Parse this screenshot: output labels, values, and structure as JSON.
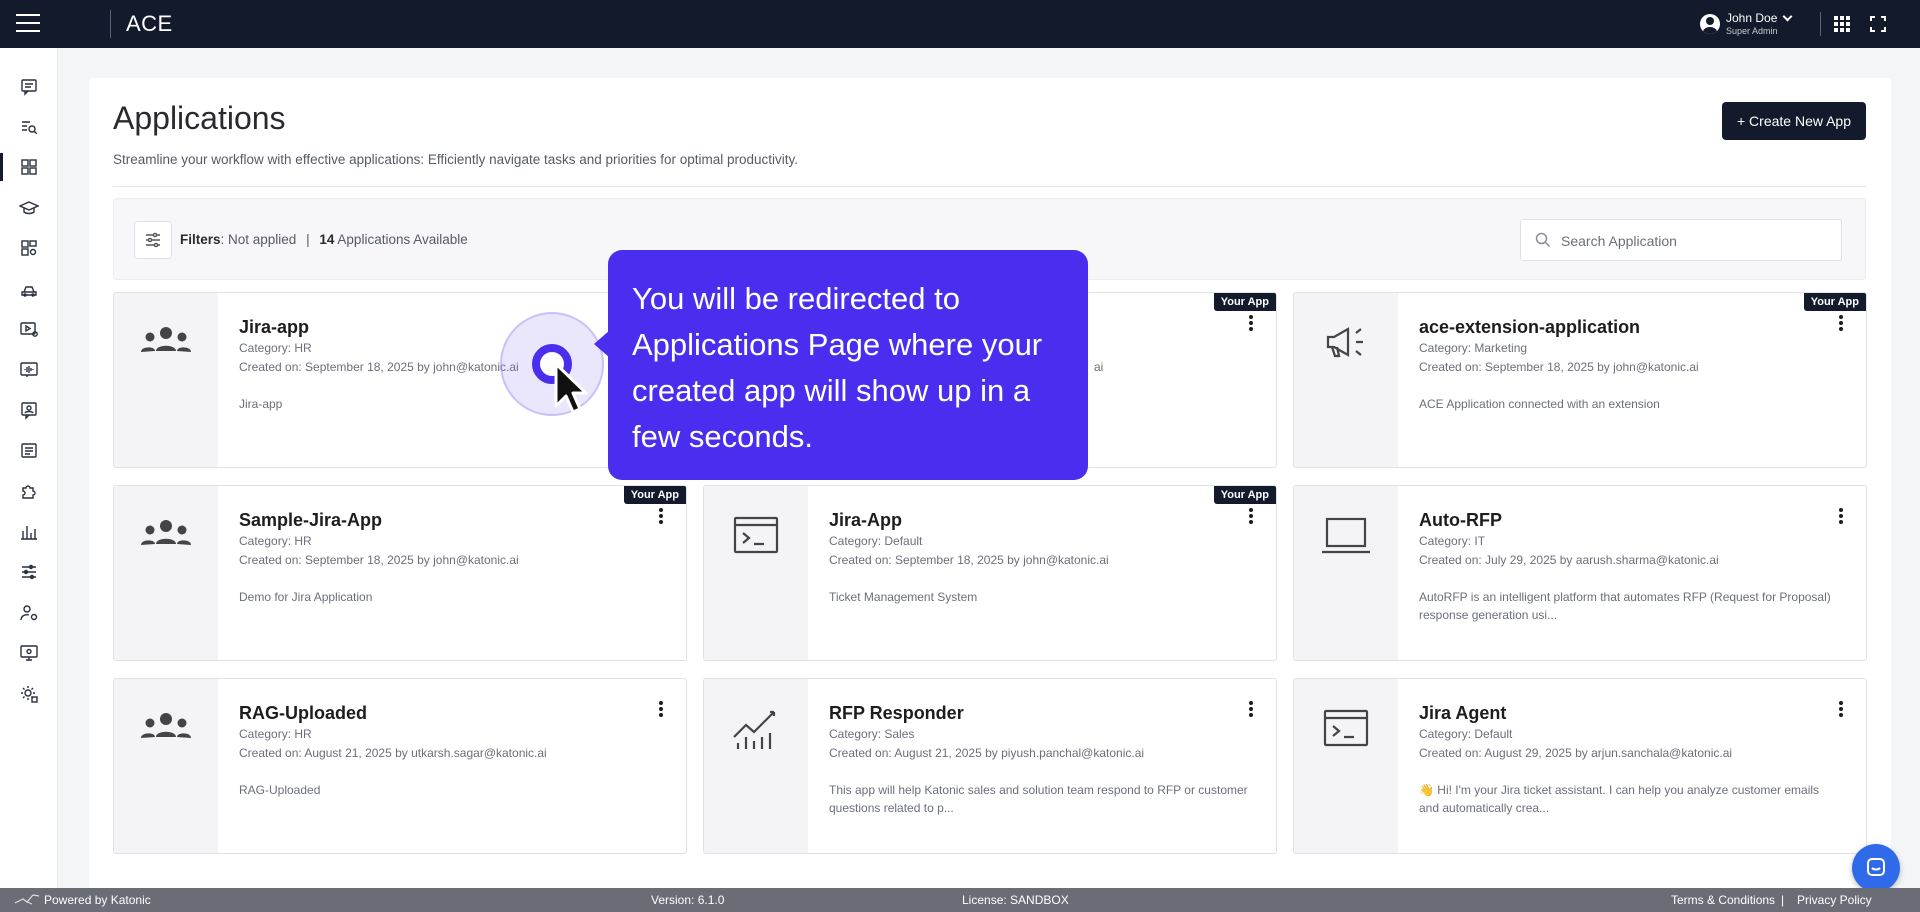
{
  "header": {
    "app_title": "ACE",
    "user_name": "John Doe",
    "user_role": "Super Admin"
  },
  "sidebar": {
    "icons": [
      "chat-icon",
      "search-list-icon",
      "apps-grid-icon",
      "graduation-cap-icon",
      "dashboard-settings-icon",
      "car-icon",
      "video-settings-icon",
      "audio-wave-icon",
      "contact-card-icon",
      "document-list-icon",
      "puzzle-icon",
      "bar-chart-icon",
      "sliders-icon",
      "user-settings-icon",
      "monitor-icon",
      "settings-gear-icon"
    ],
    "active_index": 2
  },
  "page": {
    "title": "Applications",
    "subtitle": "Streamline your workflow with effective applications: Efficiently navigate tasks and priorities for optimal productivity.",
    "create_button": "+ Create New App"
  },
  "filters": {
    "label": "Filters",
    "status": ": Not applied",
    "separator": "|",
    "count": "14",
    "count_suffix": "Applications Available",
    "search_placeholder": "Search Application"
  },
  "badge_label": "Your App",
  "apps": [
    {
      "name": "Jira-app",
      "category": "Category: HR",
      "created": "Created on: September 18, 2025 by john@katonic.ai",
      "description": "Jira-app",
      "icon": "people-group-icon",
      "your_app": false
    },
    {
      "name": "",
      "category": "",
      "created": "ai",
      "description": "",
      "icon": "",
      "your_app": true
    },
    {
      "name": "ace-extension-application",
      "category": "Category: Marketing",
      "created": "Created on: September 18, 2025 by john@katonic.ai",
      "description": "ACE Application connected with an extension",
      "icon": "megaphone-icon",
      "your_app": true
    },
    {
      "name": "Sample-Jira-App",
      "category": "Category: HR",
      "created": "Created on: September 18, 2025 by john@katonic.ai",
      "description": "Demo for Jira Application",
      "icon": "people-group-icon",
      "your_app": true
    },
    {
      "name": "Jira-App",
      "category": "Category: Default",
      "created": "Created on: September 18, 2025 by john@katonic.ai",
      "description": "Ticket Management System",
      "icon": "terminal-window-icon",
      "your_app": true
    },
    {
      "name": "Auto-RFP",
      "category": "Category: IT",
      "created": "Created on: July 29, 2025 by aarush.sharma@katonic.ai",
      "description": "AutoRFP is an intelligent platform that automates RFP (Request for Proposal) response generation usi...",
      "icon": "laptop-icon",
      "your_app": false
    },
    {
      "name": "RAG-Uploaded",
      "category": "Category: HR",
      "created": "Created on: August 21, 2025 by utkarsh.sagar@katonic.ai",
      "description": "RAG-Uploaded",
      "icon": "people-group-icon",
      "your_app": false
    },
    {
      "name": "RFP Responder",
      "category": "Category: Sales",
      "created": "Created on: August 21, 2025 by piyush.panchal@katonic.ai",
      "description": "This app will help Katonic sales and solution team respond to RFP or customer questions related to p...",
      "icon": "line-chart-icon",
      "your_app": false
    },
    {
      "name": "Jira Agent",
      "category": "Category: Default",
      "created": "Created on: August 29, 2025 by arjun.sanchala@katonic.ai",
      "description": "👋 Hi! I'm your Jira ticket assistant. I can help you analyze customer emails and automatically crea...",
      "icon": "terminal-window-icon",
      "your_app": false
    }
  ],
  "tooltip": {
    "text": "You will be redirected to Applications Page where your created app will show up in a few seconds.",
    "accent_color": "#4a2ef0"
  },
  "footer": {
    "powered_by": "Powered by Katonic",
    "version": "Version: 6.1.0",
    "license": "License: SANDBOX",
    "terms": "Terms & Conditions",
    "separator": "|",
    "privacy": "Privacy Policy"
  }
}
